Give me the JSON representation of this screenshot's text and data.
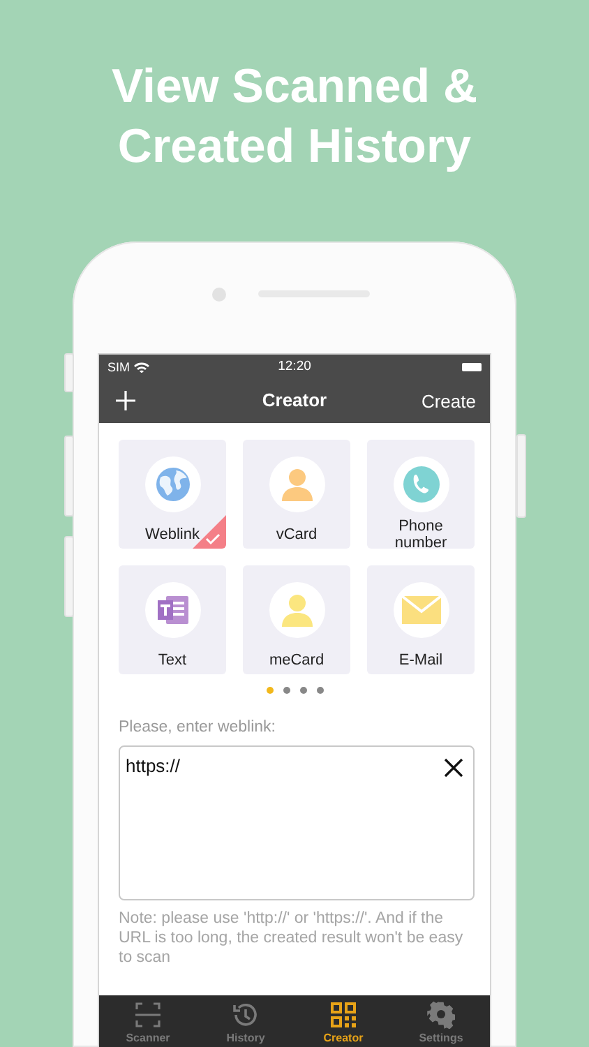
{
  "headline": {
    "lines": [
      "View Scanned &",
      "Created History"
    ]
  },
  "status_bar": {
    "carrier": "SIM",
    "time": "12:20"
  },
  "nav": {
    "title": "Creator",
    "action": "Create"
  },
  "tiles": [
    {
      "label": "Weblink",
      "selected": true
    },
    {
      "label": "vCard",
      "selected": false
    },
    {
      "label": "Phone number",
      "selected": false
    },
    {
      "label": "Text",
      "selected": false
    },
    {
      "label": "meCard",
      "selected": false
    },
    {
      "label": "E-Mail",
      "selected": false
    }
  ],
  "page_dots": [
    {
      "selected": true
    },
    {
      "selected": false
    },
    {
      "selected": false
    },
    {
      "selected": false
    }
  ],
  "form": {
    "label": "Please, enter weblink:",
    "value": "https://",
    "note": "Note: please use 'http://' or 'https://'. And if the URL is too long, the created result won't be easy to scan"
  },
  "tabs": [
    {
      "label": "Scanner",
      "selected": false
    },
    {
      "label": "History",
      "selected": false
    },
    {
      "label": "Creator",
      "selected": true
    },
    {
      "label": "Settings",
      "selected": false
    }
  ]
}
